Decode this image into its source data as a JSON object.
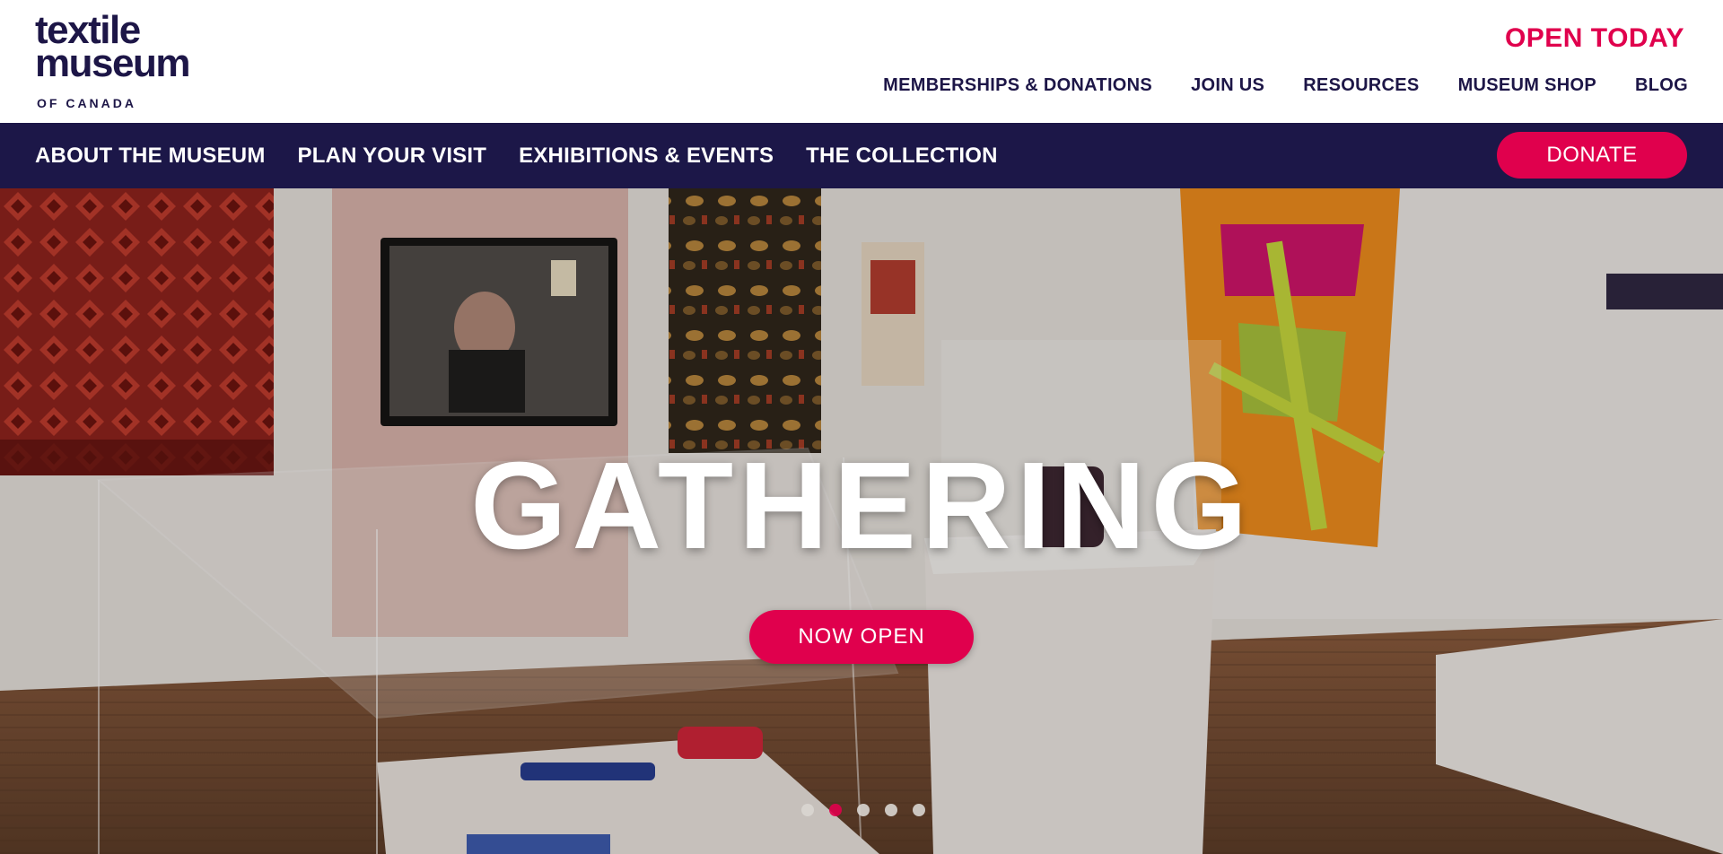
{
  "brand": {
    "logo_line1": "textile",
    "logo_line2": "museum",
    "logo_line3": "OF CANADA",
    "primary_color": "#1c1748",
    "accent_color": "#e0004d"
  },
  "header": {
    "open_today": "OPEN TODAY",
    "utility_nav": [
      {
        "label": "MEMBERSHIPS & DONATIONS"
      },
      {
        "label": "JOIN US"
      },
      {
        "label": "RESOURCES"
      },
      {
        "label": "MUSEUM SHOP"
      },
      {
        "label": "BLOG"
      }
    ]
  },
  "main_nav": {
    "items": [
      {
        "label": "ABOUT THE MUSEUM"
      },
      {
        "label": "PLAN YOUR VISIT"
      },
      {
        "label": "EXHIBITIONS & EVENTS"
      },
      {
        "label": "THE COLLECTION"
      }
    ],
    "donate_label": "DONATE"
  },
  "hero": {
    "title": "GATHERING",
    "cta_label": "NOW OPEN",
    "slides_total": 5,
    "active_slide": 2
  }
}
